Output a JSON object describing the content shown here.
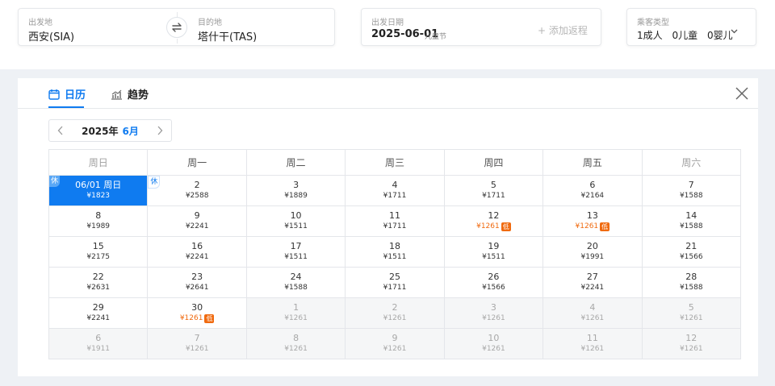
{
  "search": {
    "origin_label": "出发地",
    "origin_value": "西安(SIA)",
    "dest_label": "目的地",
    "dest_value": "塔什干(TAS)",
    "date_label": "出发日期",
    "date_value": "2025-06-01",
    "holiday": "儿童节",
    "add_return": "+ 添加返程",
    "pax_label": "乘客类型",
    "adults": "1成人",
    "children": "0儿童",
    "infants": "0婴儿"
  },
  "tabs": {
    "calendar": "日历",
    "trend": "趋势"
  },
  "month_nav": {
    "year": "2025年",
    "month": "6月"
  },
  "weekdays": [
    "周日",
    "周一",
    "周二",
    "周三",
    "周四",
    "周五",
    "周六"
  ],
  "rest_tag": "休",
  "low_tag": "低",
  "colors": {
    "accent": "#0f7bf0",
    "low_price": "#f06a0f",
    "muted": "#a8a8a8"
  },
  "icons": [
    "swap-icon",
    "calendar-icon",
    "trend-chart-icon",
    "close-icon",
    "chevron-left-icon",
    "chevron-right-icon",
    "chevron-down-icon"
  ],
  "calendar": {
    "days": [
      {
        "day": "06/01 周日",
        "price": "¥1823",
        "selected": true,
        "rest": true
      },
      {
        "day": "2",
        "price": "¥2588",
        "rest": true
      },
      {
        "day": "3",
        "price": "¥1889"
      },
      {
        "day": "4",
        "price": "¥1711"
      },
      {
        "day": "5",
        "price": "¥1711"
      },
      {
        "day": "6",
        "price": "¥2164"
      },
      {
        "day": "7",
        "price": "¥1588"
      },
      {
        "day": "8",
        "price": "¥1989"
      },
      {
        "day": "9",
        "price": "¥2241"
      },
      {
        "day": "10",
        "price": "¥1511"
      },
      {
        "day": "11",
        "price": "¥1711"
      },
      {
        "day": "12",
        "price": "¥1261",
        "low": true
      },
      {
        "day": "13",
        "price": "¥1261",
        "low": true
      },
      {
        "day": "14",
        "price": "¥1588"
      },
      {
        "day": "15",
        "price": "¥2175"
      },
      {
        "day": "16",
        "price": "¥2241"
      },
      {
        "day": "17",
        "price": "¥1511"
      },
      {
        "day": "18",
        "price": "¥1511"
      },
      {
        "day": "19",
        "price": "¥1511"
      },
      {
        "day": "20",
        "price": "¥1991"
      },
      {
        "day": "21",
        "price": "¥1566"
      },
      {
        "day": "22",
        "price": "¥2631"
      },
      {
        "day": "23",
        "price": "¥2641"
      },
      {
        "day": "24",
        "price": "¥1588"
      },
      {
        "day": "25",
        "price": "¥1711"
      },
      {
        "day": "26",
        "price": "¥1566"
      },
      {
        "day": "27",
        "price": "¥2241"
      },
      {
        "day": "28",
        "price": "¥1588"
      },
      {
        "day": "29",
        "price": "¥2241"
      },
      {
        "day": "30",
        "price": "¥1261",
        "low": true
      },
      {
        "day": "1",
        "price": "¥1261",
        "out": true
      },
      {
        "day": "2",
        "price": "¥1261",
        "out": true
      },
      {
        "day": "3",
        "price": "¥1261",
        "out": true
      },
      {
        "day": "4",
        "price": "¥1261",
        "out": true
      },
      {
        "day": "5",
        "price": "¥1261",
        "out": true
      },
      {
        "day": "6",
        "price": "¥1911",
        "out": true
      },
      {
        "day": "7",
        "price": "¥1261",
        "out": true
      },
      {
        "day": "8",
        "price": "¥1261",
        "out": true
      },
      {
        "day": "9",
        "price": "¥1261",
        "out": true
      },
      {
        "day": "10",
        "price": "¥1261",
        "out": true
      },
      {
        "day": "11",
        "price": "¥1261",
        "out": true
      },
      {
        "day": "12",
        "price": "¥1261",
        "out": true
      }
    ]
  }
}
